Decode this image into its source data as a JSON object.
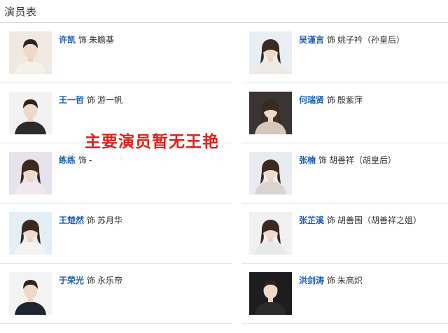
{
  "header": {
    "title": "演员表"
  },
  "overlay_text": "主要演员暂无王艳",
  "shi_label": "饰",
  "cast": [
    {
      "actor": "许凯",
      "role": "朱瞻基",
      "photo_icon": "actor-portrait",
      "bg": "#efe9e1",
      "shirt": "#f4f0ea"
    },
    {
      "actor": "吴谨言",
      "role": "姚子衿（孙皇后）",
      "photo_icon": "actress-portrait",
      "bg": "#e9eef2",
      "shirt": "#efe9e4"
    },
    {
      "actor": "王一哲",
      "role": "游一帆",
      "photo_icon": "actor-portrait",
      "bg": "#f2f2f2",
      "shirt": "#2b2b2b"
    },
    {
      "actor": "何瑞贤",
      "role": "殷紫萍",
      "photo_icon": "actress-portrait",
      "bg": "#3a3532",
      "shirt": "#d7c7b8"
    },
    {
      "actor": "练练",
      "role": "-",
      "photo_icon": "actress-portrait",
      "bg": "#e7e2ec",
      "shirt": "#f1e8ee"
    },
    {
      "actor": "张楠",
      "role": "胡善祥（胡皇后）",
      "photo_icon": "actress-portrait",
      "bg": "#e8ecf0",
      "shirt": "#d9d4d0"
    },
    {
      "actor": "王楚然",
      "role": "苏月华",
      "photo_icon": "actress-portrait",
      "bg": "#e6eef5",
      "shirt": "#f3f3f3"
    },
    {
      "actor": "张芷溪",
      "role": "胡善围（胡善祥之姐）",
      "photo_icon": "actress-portrait",
      "bg": "#f1f1f1",
      "shirt": "#e9e9e9"
    },
    {
      "actor": "于荣光",
      "role": "永乐帝",
      "photo_icon": "actor-portrait",
      "bg": "#f3f3f3",
      "shirt": "#1e2530"
    },
    {
      "actor": "洪剑涛",
      "role": "朱高炽",
      "photo_icon": "actor-portrait",
      "bg": "#1d1d1f",
      "shirt": "#2a2a2a"
    }
  ]
}
